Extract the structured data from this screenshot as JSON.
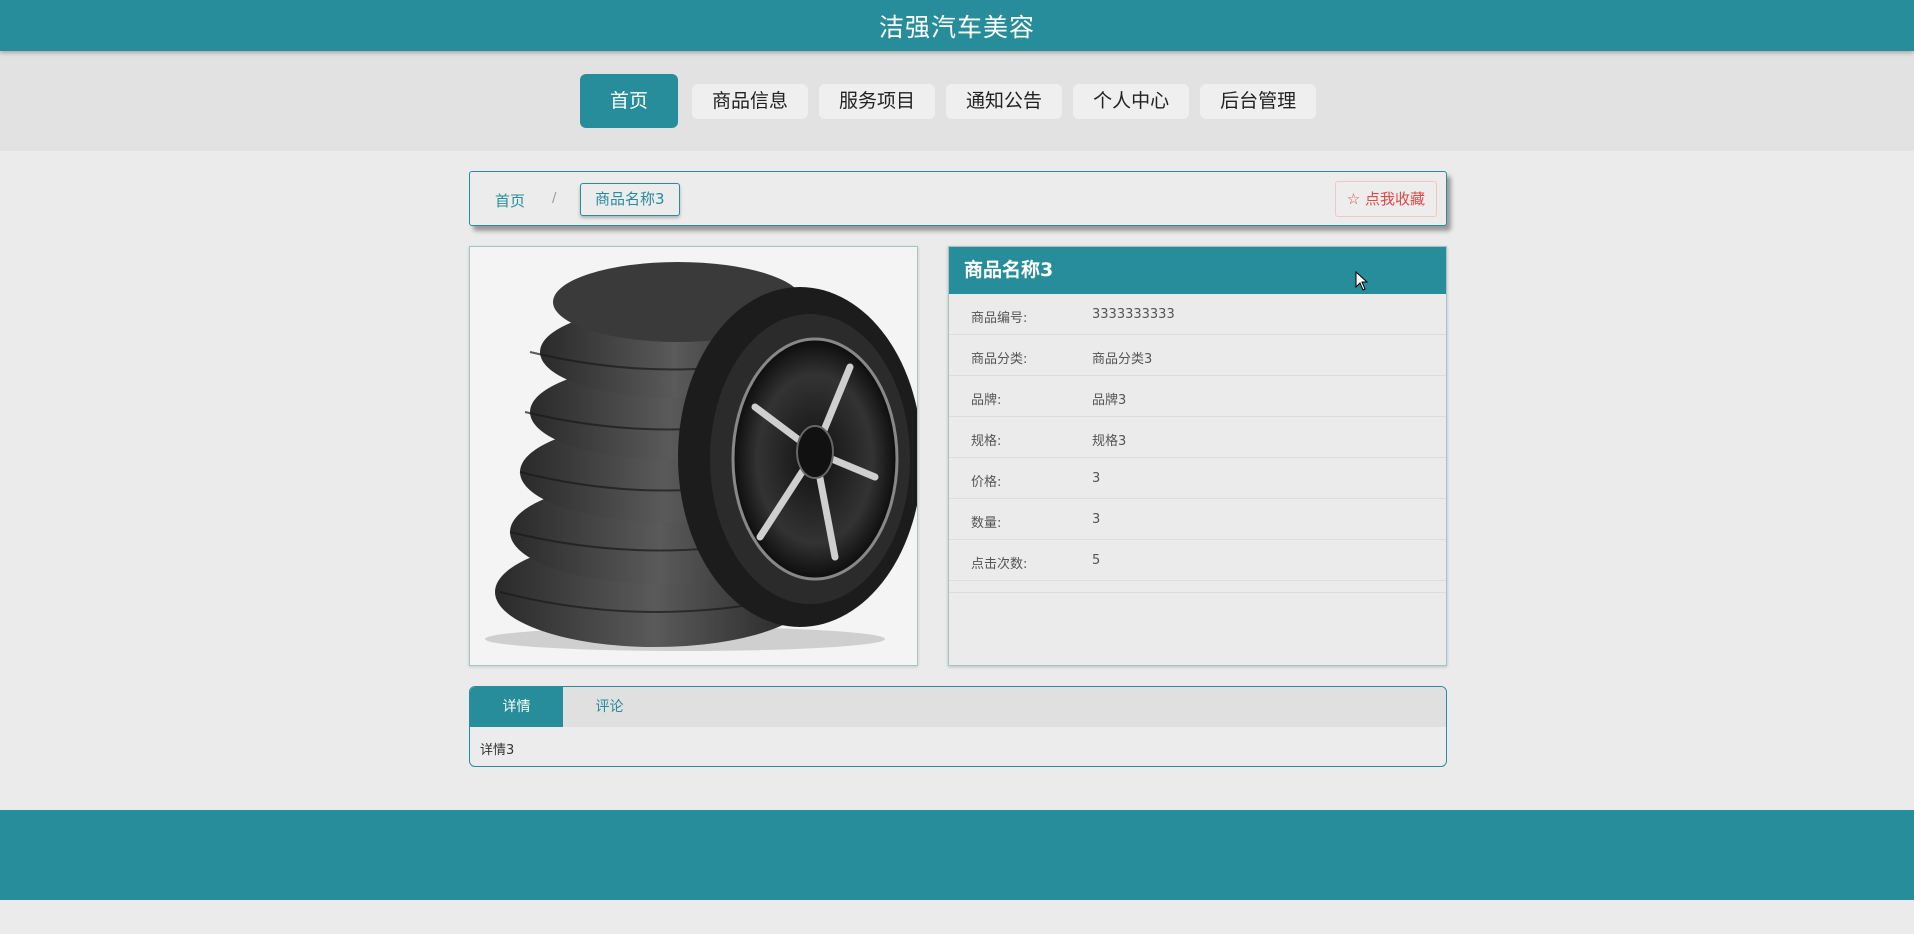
{
  "header": {
    "title": "洁强汽车美容"
  },
  "nav": {
    "items": [
      {
        "label": "首页",
        "active": true
      },
      {
        "label": "商品信息"
      },
      {
        "label": "服务项目"
      },
      {
        "label": "通知公告"
      },
      {
        "label": "个人中心"
      },
      {
        "label": "后台管理"
      }
    ]
  },
  "breadcrumb": {
    "home": "首页",
    "separator": "/",
    "current": "商品名称3"
  },
  "favorite": {
    "label": "☆ 点我收藏"
  },
  "product": {
    "name": "商品名称3",
    "image_alt": "tire-stack-image",
    "fields": [
      {
        "label": "商品编号:",
        "value": "3333333333"
      },
      {
        "label": "商品分类:",
        "value": "商品分类3"
      },
      {
        "label": "品牌:",
        "value": "品牌3"
      },
      {
        "label": "规格:",
        "value": "规格3"
      },
      {
        "label": "价格:",
        "value": "3"
      },
      {
        "label": "数量:",
        "value": "3"
      },
      {
        "label": "点击次数:",
        "value": "5"
      }
    ]
  },
  "tabs": {
    "items": [
      {
        "label": "详情",
        "active": true
      },
      {
        "label": "评论"
      }
    ],
    "content": "详情3"
  },
  "colors": {
    "primary": "#278d9a",
    "background": "#ebebeb",
    "nav_band": "#e2e2e3",
    "favorite": "#e04848"
  }
}
